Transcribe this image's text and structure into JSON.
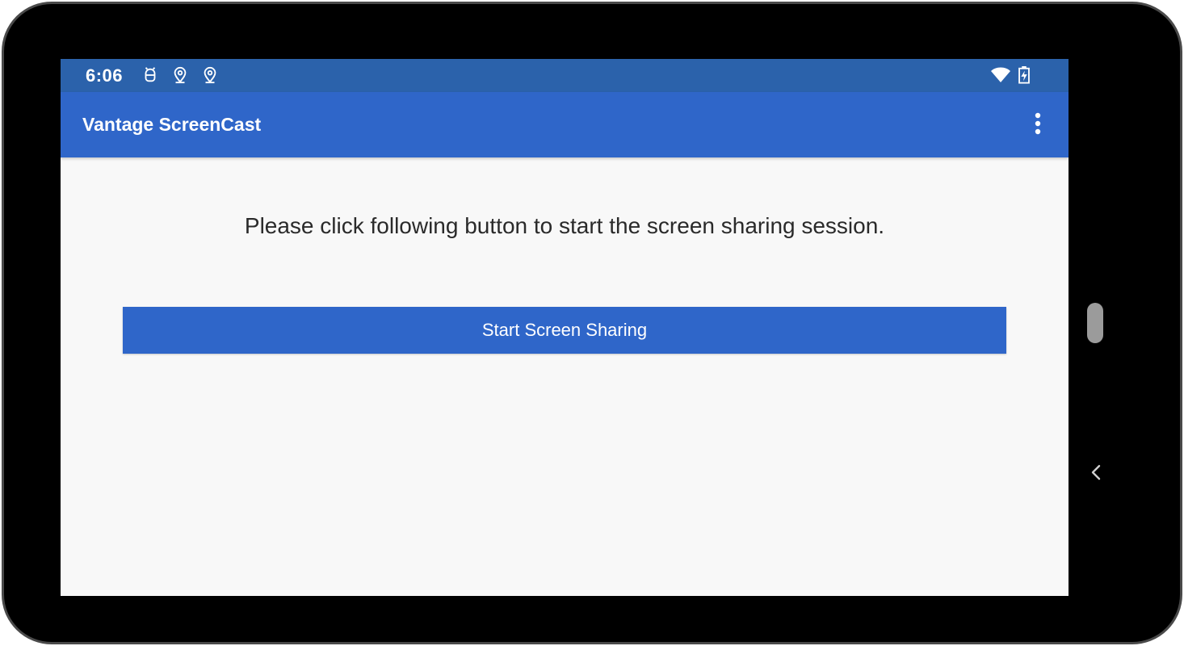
{
  "status_bar": {
    "time": "6:06",
    "icons_left": [
      "android-debug-icon",
      "location-icon",
      "location-icon"
    ],
    "icons_right": [
      "wifi-icon",
      "battery-charging-icon"
    ],
    "color": "#2b62ab"
  },
  "app_bar": {
    "title": "Vantage ScreenCast",
    "menu_icon": "more-vert-icon",
    "color": "#2f66c9"
  },
  "main": {
    "instruction": "Please click following button to start the screen sharing session.",
    "start_button_label": "Start Screen Sharing",
    "button_color": "#2f66c9"
  },
  "device": {
    "nav_icon": "back-chevron-icon"
  }
}
